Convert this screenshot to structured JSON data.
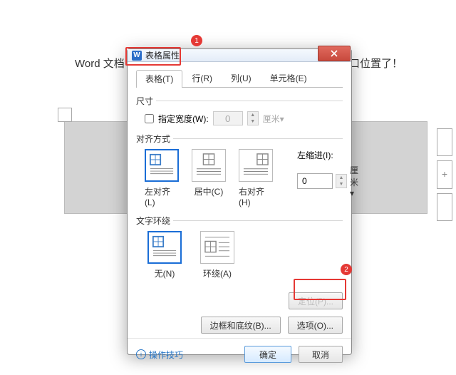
{
  "document": {
    "left_text": "Word 文档中",
    "right_text": "口位置了！"
  },
  "dialog": {
    "title": "表格属性",
    "tabs": [
      "表格(T)",
      "行(R)",
      "列(U)",
      "单元格(E)"
    ],
    "active_tab_index": 0,
    "size": {
      "section": "尺寸",
      "preferred_width_label": "指定宽度(W):",
      "preferred_width_value": "0",
      "unit": "厘米▾"
    },
    "alignment": {
      "section": "对齐方式",
      "options": [
        "左对齐(L)",
        "居中(C)",
        "右对齐(H)"
      ],
      "selected_index": 0,
      "indent_label": "左缩进(I):",
      "indent_value": "0",
      "indent_unit": "厘米▾"
    },
    "wrap": {
      "section": "文字环绕",
      "options": [
        "无(N)",
        "环绕(A)"
      ],
      "selected_index": 0,
      "position_button": "定位(P)..."
    },
    "bottom": {
      "borders_button": "边框和底纹(B)...",
      "options_button": "选项(O)..."
    },
    "footer": {
      "tips": "操作技巧",
      "ok": "确定",
      "cancel": "取消"
    }
  },
  "annotations": {
    "badge1": "1",
    "badge2": "2"
  }
}
